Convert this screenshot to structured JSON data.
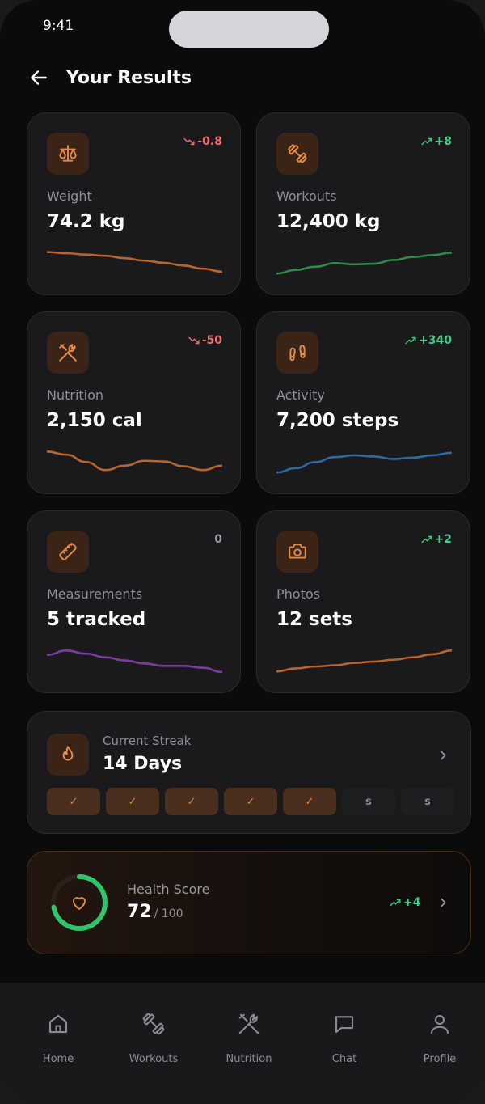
{
  "status_bar": {
    "time": "9:41"
  },
  "header": {
    "title": "Your Results"
  },
  "colors": {
    "accent": "#e58b45",
    "up": "#3fcf84",
    "down": "#f06d6d",
    "background": "#0b0b0c",
    "card": "#1a1a1d"
  },
  "cards": [
    {
      "label": "Weight",
      "value": "74.2 kg",
      "delta": "-0.8",
      "trend": "down",
      "icon": "scale-icon",
      "line_color": "#b8642e",
      "series": [
        8,
        7.6,
        7.2,
        6.8,
        6.0,
        5.2,
        4.5,
        3.6,
        2.6,
        1.6
      ]
    },
    {
      "label": "Workouts",
      "value": "12,400 kg",
      "delta": "+8",
      "trend": "up",
      "icon": "dumbbell-icon",
      "line_color": "#2f8a4a",
      "series": [
        1,
        2.2,
        3.2,
        4.4,
        4.0,
        4.2,
        5.4,
        6.4,
        7.0,
        7.8
      ]
    },
    {
      "label": "Nutrition",
      "value": "2,150 cal",
      "delta": "-50",
      "trend": "down",
      "icon": "utensils-icon",
      "line_color": "#b8642e",
      "series": [
        7.8,
        6.8,
        4.4,
        1.8,
        3.2,
        4.8,
        4.6,
        3.0,
        1.8,
        3.2
      ]
    },
    {
      "label": "Activity",
      "value": "7,200 steps",
      "delta": "+340",
      "trend": "up",
      "icon": "footprints-icon",
      "line_color": "#2e6aa0",
      "series": [
        1,
        2.4,
        4.4,
        6.0,
        6.6,
        6.2,
        5.4,
        5.8,
        6.6,
        7.4
      ]
    },
    {
      "label": "Measurements",
      "value": "5 tracked",
      "delta": "0",
      "trend": "flat",
      "icon": "ruler-icon",
      "line_color": "#7a3d9e",
      "series": [
        6.4,
        7.8,
        6.8,
        5.6,
        4.6,
        3.6,
        2.8,
        2.8,
        2.2,
        0.8
      ]
    },
    {
      "label": "Photos",
      "value": "12 sets",
      "delta": "+2",
      "trend": "up",
      "icon": "camera-icon",
      "line_color": "#b8642e",
      "series": [
        1,
        2.0,
        2.6,
        3.0,
        3.8,
        4.2,
        4.8,
        5.6,
        6.6,
        7.8
      ]
    }
  ],
  "streak": {
    "label": "Current Streak",
    "value": "14 Days",
    "days": [
      {
        "mark": "✓",
        "done": true
      },
      {
        "mark": "✓",
        "done": true
      },
      {
        "mark": "✓",
        "done": true
      },
      {
        "mark": "✓",
        "done": true
      },
      {
        "mark": "✓",
        "done": true
      },
      {
        "mark": "s",
        "done": false
      },
      {
        "mark": "s",
        "done": false
      }
    ]
  },
  "health": {
    "label": "Health Score",
    "value": "72",
    "max": "/ 100",
    "progress": 0.72,
    "delta": "+4"
  },
  "tabs": [
    {
      "label": "Home",
      "icon": "home-icon"
    },
    {
      "label": "Workouts",
      "icon": "dumbbell-icon"
    },
    {
      "label": "Nutrition",
      "icon": "utensils-icon"
    },
    {
      "label": "Chat",
      "icon": "chat-icon"
    },
    {
      "label": "Profile",
      "icon": "user-icon"
    }
  ]
}
